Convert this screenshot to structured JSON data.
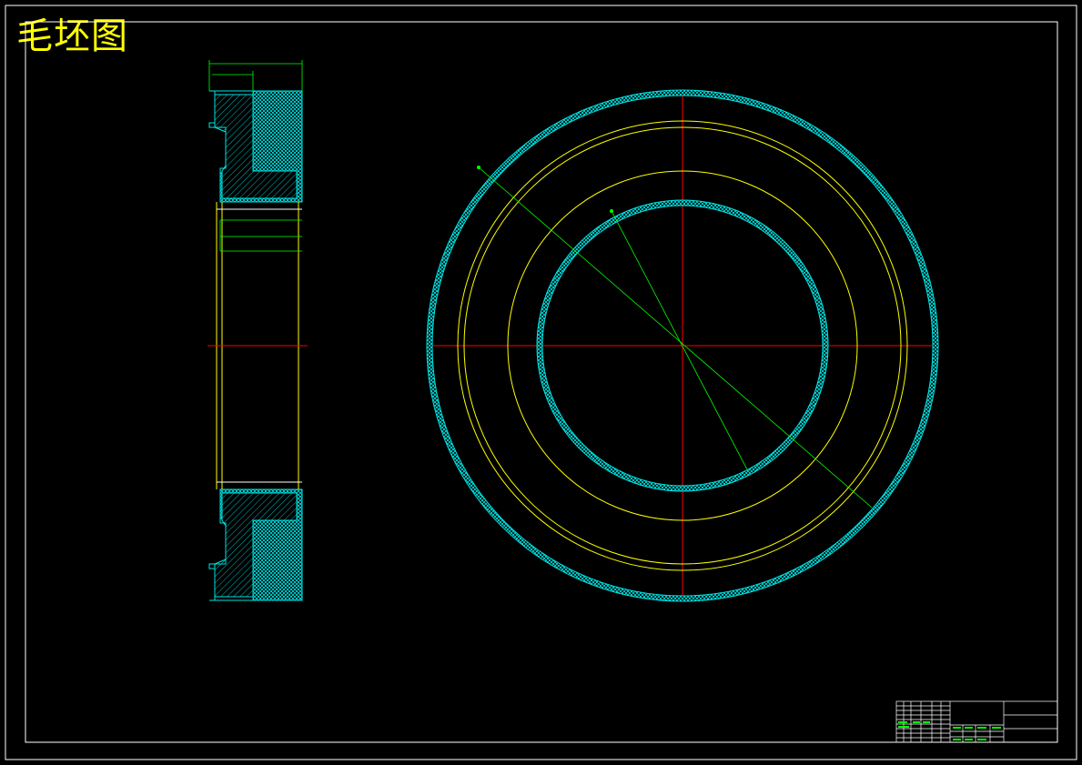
{
  "drawing": {
    "title": "毛坯图"
  },
  "colors": {
    "background": "#000000",
    "frame": "#ffffff",
    "title_text": "#ffff00",
    "centerline": "#ff0000",
    "hatch": "#00e5e5",
    "outline": "#ffff00",
    "dimension": "#00ff00"
  }
}
